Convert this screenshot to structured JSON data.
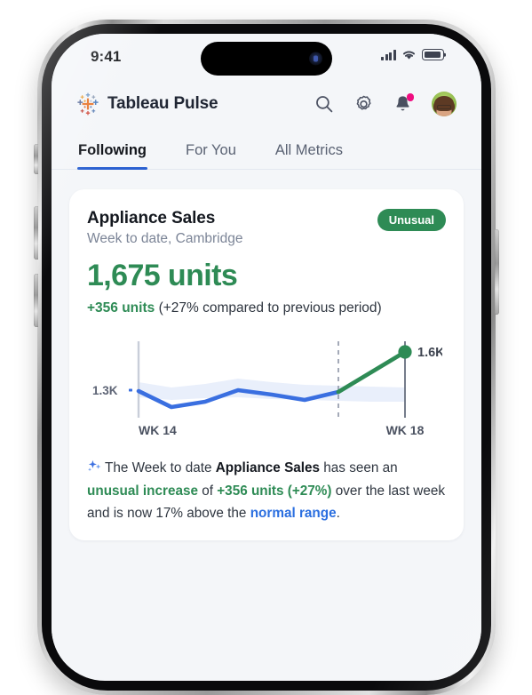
{
  "status_bar": {
    "time": "9:41",
    "signal_icon": "cellular-bars-icon",
    "wifi_icon": "wifi-icon",
    "battery_icon": "battery-icon"
  },
  "header": {
    "logo_icon": "tableau-logo-icon",
    "app_name": "Tableau Pulse",
    "search_icon": "search-icon",
    "settings_icon": "gear-icon",
    "notifications_icon": "bell-icon",
    "avatar_icon": "user-avatar"
  },
  "tabs": [
    {
      "label": "Following",
      "active": true
    },
    {
      "label": "For You",
      "active": false
    },
    {
      "label": "All Metrics",
      "active": false
    }
  ],
  "card": {
    "title": "Appliance Sales",
    "subtitle": "Week to date, Cambridge",
    "badge": "Unusual",
    "value": "1,675 units",
    "delta_value": "+356 units",
    "delta_context": "(+27% compared to previous period)",
    "insight": {
      "sparkle_icon": "ai-sparkle-icon",
      "p1": "The Week to date ",
      "b1": "Appliance Sales",
      "p2": " has seen an ",
      "g1": "unusual increase",
      "p3": " of ",
      "g2": "+356 units (+27%)",
      "p4": " over the last week and is now 17% above the ",
      "link": "normal range",
      "p5": "."
    }
  },
  "colors": {
    "accent_green": "#2e8B55",
    "accent_blue": "#2b61d1",
    "line_blue": "#3a6fe0",
    "band_blue": "#e8eefb",
    "link_blue": "#2b6fe0",
    "badge_green": "#2e8B55",
    "notification_pink": "#ef0d80",
    "screen_bg": "#f4f6f9"
  },
  "chart_data": {
    "type": "line",
    "title": "",
    "xlabel": "",
    "ylabel": "",
    "y_tick_labels": [
      "1.3K"
    ],
    "x_tick_labels": [
      "WK 14",
      "WK 18"
    ],
    "end_point_label": "1.6K",
    "grid": false,
    "legend_position": "none",
    "axis_lines": [
      "WK 14 start axis",
      "WK 18 end axis"
    ],
    "forecast_divider": "dashed vertical line before final segment",
    "series": [
      {
        "name": "Appliance Sales (actual)",
        "color": "#3a6fe0",
        "x": [
          "WK 14",
          "WK 14.5",
          "WK 15",
          "WK 15.5",
          "WK 16",
          "WK 16.5",
          "WK 17",
          "WK 17.5"
        ],
        "values": [
          1300,
          1215,
          1240,
          1320,
          1285,
          1255,
          1300,
          1360
        ]
      },
      {
        "name": "Appliance Sales (current / unusual)",
        "color": "#2e8B55",
        "x": [
          "WK 17.5",
          "WK 18"
        ],
        "values": [
          1360,
          1600
        ]
      }
    ],
    "band": {
      "name": "normal range",
      "color": "#e8eefb",
      "upper": [
        1360,
        1345,
        1375,
        1395,
        1370,
        1355,
        1350,
        1345,
        1340
      ],
      "lower": [
        1235,
        1205,
        1215,
        1230,
        1225,
        1220,
        1225,
        1230,
        1235
      ]
    },
    "ylim": [
      1150,
      1680
    ]
  }
}
